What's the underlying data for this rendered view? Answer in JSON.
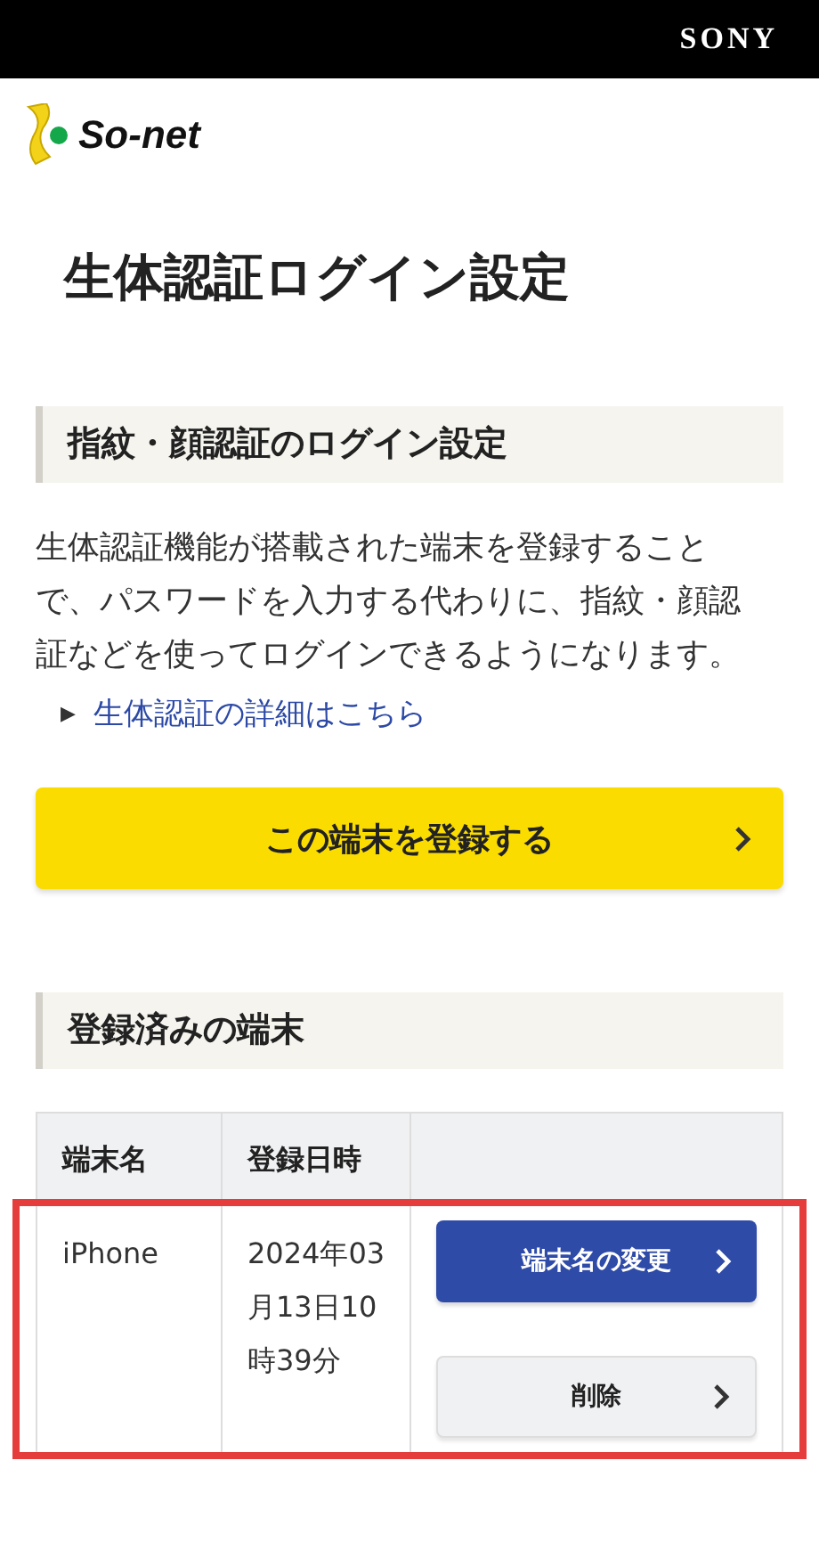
{
  "header": {
    "brand": "SONY"
  },
  "logo": {
    "text": "So-net"
  },
  "page_title": "生体認証ログイン設定",
  "sections": [
    {
      "heading": "指紋・顔認証のログイン設定",
      "description": "生体認証機能が搭載された端末を登録することで、パスワードを入力する代わりに、指紋・顔認証などを使ってログインできるようになります。",
      "link": "生体認証の詳細はこちら",
      "link_marker": "▶",
      "button": "この端末を登録する"
    },
    {
      "heading": "登録済みの端末"
    }
  ],
  "table": {
    "columns": [
      "端末名",
      "登録日時"
    ],
    "rows": [
      {
        "name": "iPhone",
        "registered": "2024年03月13日10時39分",
        "highlighted": true,
        "actions": [
          {
            "label": "端末名の変更",
            "kind": "primary"
          },
          {
            "label": "削除",
            "kind": "secondary"
          }
        ]
      }
    ]
  }
}
